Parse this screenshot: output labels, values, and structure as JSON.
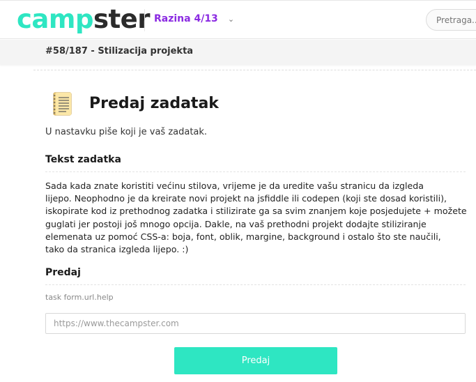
{
  "header": {
    "logo_part1": "camp",
    "logo_part2": "ster",
    "level_label": "Razina 4/13",
    "search_placeholder": "Pretraga..."
  },
  "breadcrumb": {
    "text": "#58/187 - Stilizacija projekta"
  },
  "main": {
    "title": "Predaj zadatak",
    "intro": "U nastavku piše koji je vaš zadatak.",
    "task_heading": "Tekst zadatka",
    "task_lines": [
      "Sada kada znate koristiti većinu stilova, vrijeme je da uredite vašu stranicu da izgleda",
      "lijepo. Neophodno je da kreirate novi projekt na jsfiddle ili codepen (koji ste dosad koristili),",
      "iskopirate kod iz prethodnog zadatka i stilizirate ga sa svim znanjem koje posjedujete + možete",
      "guglati jer postoji još mnogo opcija. Dakle, na vaš prethodni projekt dodajte stiliziranje",
      "elemenata uz pomoć CSS-a:  boja,  font,  oblik,  margine,  background i  ostalo što ste naučili,",
      "tako da stranica izgleda lijepo. :)"
    ],
    "submit_heading": "Predaj",
    "help_text": "task form.url.help",
    "url_placeholder": "https://www.thecampster.com",
    "submit_label": "Predaj"
  },
  "colors": {
    "accent": "#2ee6c2",
    "level": "#8b2be2"
  }
}
